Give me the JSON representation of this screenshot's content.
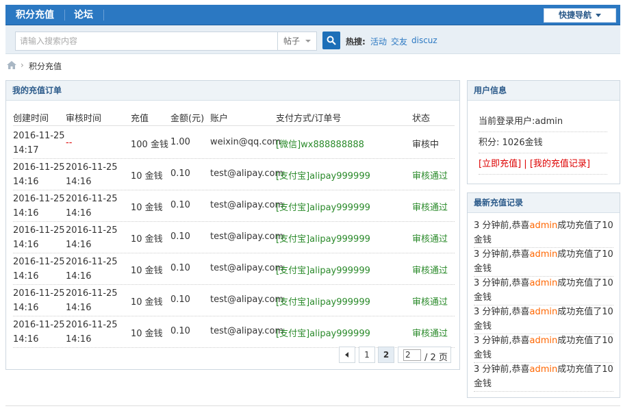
{
  "topnav": {
    "item1": "积分充值",
    "item2": "论坛",
    "quick_nav": "快捷导航"
  },
  "search": {
    "placeholder": "请输入搜索内容",
    "type": "帖子",
    "hot_label": "热搜:",
    "hot_links": [
      "活动",
      "交友",
      "discuz"
    ]
  },
  "breadcrumb": {
    "current": "积分充值"
  },
  "orders": {
    "title": "我的充值订单",
    "headers": [
      "创建时间",
      "审核时间",
      "充值",
      "金额(元)",
      "账户",
      "支付方式/订单号",
      "状态"
    ],
    "rows": [
      {
        "created_date": "2016-11-25",
        "created_time": "14:17",
        "review_date": "--",
        "review_time": "",
        "amount": "100 金钱",
        "money": "1.00",
        "account": "weixin@qq.com",
        "pay": "[微信]wx888888888",
        "status": "审核中"
      },
      {
        "created_date": "2016-11-25",
        "created_time": "14:16",
        "review_date": "2016-11-25",
        "review_time": "14:16",
        "amount": "10 金钱",
        "money": "0.10",
        "account": "test@alipay.com",
        "pay": "[支付宝]alipay999999",
        "status": "审核通过"
      },
      {
        "created_date": "2016-11-25",
        "created_time": "14:16",
        "review_date": "2016-11-25",
        "review_time": "14:16",
        "amount": "10 金钱",
        "money": "0.10",
        "account": "test@alipay.com",
        "pay": "[支付宝]alipay999999",
        "status": "审核通过"
      },
      {
        "created_date": "2016-11-25",
        "created_time": "14:16",
        "review_date": "2016-11-25",
        "review_time": "14:16",
        "amount": "10 金钱",
        "money": "0.10",
        "account": "test@alipay.com",
        "pay": "[支付宝]alipay999999",
        "status": "审核通过"
      },
      {
        "created_date": "2016-11-25",
        "created_time": "14:16",
        "review_date": "2016-11-25",
        "review_time": "14:16",
        "amount": "10 金钱",
        "money": "0.10",
        "account": "test@alipay.com",
        "pay": "[支付宝]alipay999999",
        "status": "审核通过"
      },
      {
        "created_date": "2016-11-25",
        "created_time": "14:16",
        "review_date": "2016-11-25",
        "review_time": "14:16",
        "amount": "10 金钱",
        "money": "0.10",
        "account": "test@alipay.com",
        "pay": "[支付宝]alipay999999",
        "status": "审核通过"
      },
      {
        "created_date": "2016-11-25",
        "created_time": "14:16",
        "review_date": "2016-11-25",
        "review_time": "14:16",
        "amount": "10 金钱",
        "money": "0.10",
        "account": "test@alipay.com",
        "pay": "[支付宝]alipay999999",
        "status": "审核通过"
      }
    ]
  },
  "pager": {
    "pages": [
      "1",
      "2"
    ],
    "current": "2",
    "input_value": "2",
    "total": "/ 2 页"
  },
  "userinfo": {
    "title": "用户信息",
    "current_user": "当前登录用户:admin",
    "points": "积分: 1026金钱",
    "recharge_link": "[立即充值]",
    "divider": "|",
    "records_link": "[我的充值记录]"
  },
  "recent": {
    "title": "最新充值记录",
    "items": [
      {
        "prefix": "3 分钟前,恭喜",
        "user": "admin",
        "suffix": "成功充值了10",
        "line2": "金钱"
      },
      {
        "prefix": "3 分钟前,恭喜",
        "user": "admin",
        "suffix": "成功充值了10",
        "line2": "金钱"
      },
      {
        "prefix": "3 分钟前,恭喜",
        "user": "admin",
        "suffix": "成功充值了10",
        "line2": "金钱"
      },
      {
        "prefix": "3 分钟前,恭喜",
        "user": "admin",
        "suffix": "成功充值了10",
        "line2": "金钱"
      },
      {
        "prefix": "3 分钟前,恭喜",
        "user": "admin",
        "suffix": "成功充值了10",
        "line2": "金钱"
      },
      {
        "prefix": "3 分钟前,恭喜",
        "user": "admin",
        "suffix": "成功充值了10",
        "line2": "金钱"
      }
    ]
  },
  "colors": {
    "brand": "#2b78c2",
    "status_ok": "#2a8a2a",
    "pending_dash": "#dd0000",
    "highlight_user": "#ff6600"
  }
}
